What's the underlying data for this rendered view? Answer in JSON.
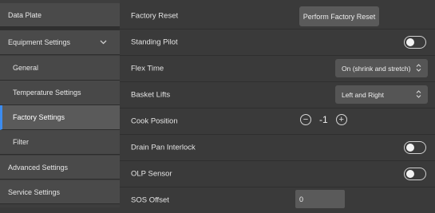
{
  "sidebar": {
    "items": [
      {
        "label": "Data Plate"
      },
      {
        "label": "Equipment Settings"
      },
      {
        "label": "General"
      },
      {
        "label": "Temperature Settings"
      },
      {
        "label": "Factory Settings"
      },
      {
        "label": "Filter"
      },
      {
        "label": "Advanced Settings"
      },
      {
        "label": "Service Settings"
      }
    ],
    "selected": "Factory Settings",
    "accent_color": "#3c8cf0"
  },
  "main": {
    "factory_reset": {
      "label": "Factory Reset",
      "button": "Perform Factory Reset"
    },
    "standing_pilot": {
      "label": "Standing Pilot",
      "state": "off"
    },
    "flex_time": {
      "label": "Flex Time",
      "value": "On (shrink and stretch)"
    },
    "basket_lifts": {
      "label": "Basket Lifts",
      "value": "Left and Right"
    },
    "cook_position": {
      "label": "Cook Position",
      "value": "-1",
      "minus": "−",
      "plus": "+"
    },
    "drain_pan_interlock": {
      "label": "Drain Pan Interlock",
      "state": "off"
    },
    "olp_sensor": {
      "label": "OLP Sensor",
      "state": "off"
    },
    "sos_offset": {
      "label": "SOS Offset",
      "value": "0"
    }
  }
}
